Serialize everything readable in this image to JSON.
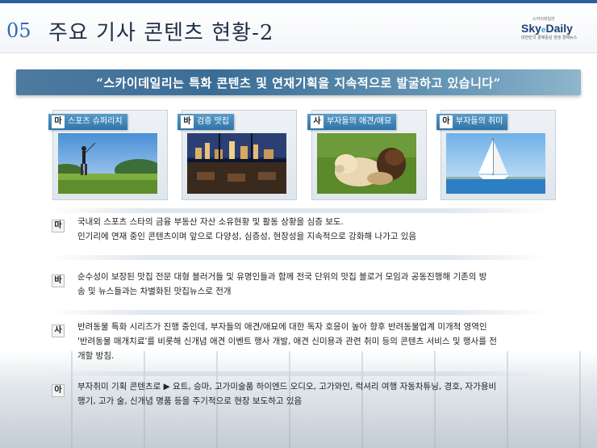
{
  "header": {
    "section_number": "05",
    "title": "주요 기사 콘텐츠 현황-2",
    "logo": {
      "small": "스카이데일리",
      "main_a": "Sky",
      "main_b": "e",
      "main_c": "Daily",
      "sub": "대한민국 경제중심 생생 경제뉴스"
    }
  },
  "banner": {
    "text": "“스카이데일리는 특화 콘텐츠 및 연재기획을 지속적으로 발굴하고 있습니다”"
  },
  "categories": [
    {
      "badge": "마",
      "label": "스포츠 슈퍼리치",
      "photo": "golfer-on-green-image"
    },
    {
      "badge": "바",
      "label": "검증 맛집",
      "photo": "restaurant-city-view-image"
    },
    {
      "badge": "사",
      "label": "부자들의 애견/애묘",
      "photo": "dogs-on-grass-image"
    },
    {
      "badge": "아",
      "label": "부자들의 취미",
      "photo": "sailboat-image"
    }
  ],
  "rows": [
    {
      "badge": "마",
      "lines": [
        "국내외 스포츠 스타의 금융 부동산 자산 소유현황 및 활동 상황을 심층 보도.",
        "인기리에 연재 중인 콘텐츠이며 앞으로 다양성, 심층성, 현장성을 지속적으로 강화해 나가고 있음"
      ]
    },
    {
      "badge": "바",
      "lines": [
        "순수성이 보장된 맛집 전문 대형 블러거들 및 유명인들과 함께 전국 단위의 맛집 블로거 모임과 공동진행해 기존의 방",
        "송 및 뉴스들과는 차별화된 맛집뉴스로 전개"
      ]
    },
    {
      "badge": "사",
      "lines": [
        "반려동물 특화 시리즈가 진행 중인데, 부자들의 애견/애묘에 대한 독자 호응이 높아 향후 반려동물업계 미개척 영역인",
        "'반려동물 매개치료'를 비롯해 신개념 애견 이벤트 행사 개발, 애견 신미용과 관련 취미 등의 콘텐츠 서비스 및 행사를 전",
        "개할 방침."
      ]
    },
    {
      "badge": "아",
      "lines": [
        "부자취미 기획  콘텐츠로 ▶ 요트, 승마, 고가미술품 하이엔드 오디오, 고가와인, 럭셔리 여행 자동차튜닝, 경호, 자가용비",
        "행기, 고가 술, 신개념 명품 등을 주기적으로 현장 보도하고 있음"
      ]
    }
  ],
  "colors": {
    "accent": "#2f6bb3",
    "title": "#1f2f44",
    "banner": "#3a6d96",
    "tab": "#2f74a8"
  }
}
